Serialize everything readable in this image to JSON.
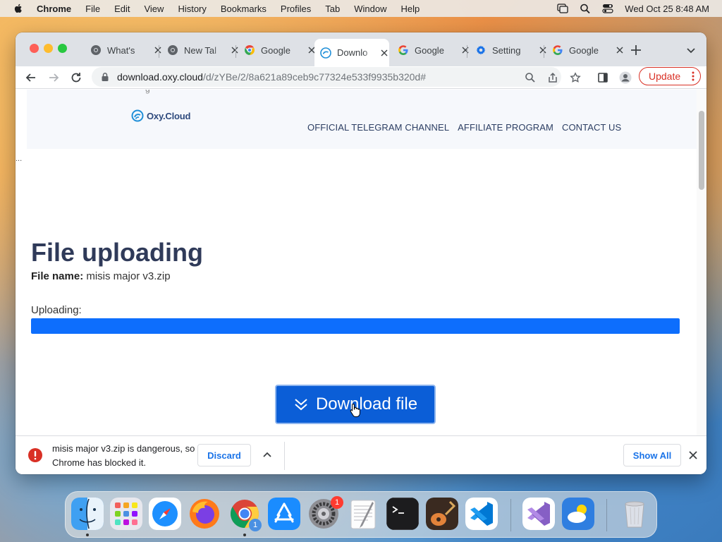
{
  "menubar": {
    "app_name": "Chrome",
    "items": [
      "File",
      "Edit",
      "View",
      "History",
      "Bookmarks",
      "Profiles",
      "Tab",
      "Window",
      "Help"
    ],
    "datetime": "Wed Oct 25  8:48 AM"
  },
  "tabs": [
    {
      "title": "What's",
      "icon": "chrome-logo-icon"
    },
    {
      "title": "New Tal",
      "icon": "chrome-logo-icon"
    },
    {
      "title": "Google",
      "icon": "chrome-color-icon"
    },
    {
      "title": "Downlo",
      "icon": "oxycloud-icon",
      "active": true
    },
    {
      "title": "Google",
      "icon": "google-g-icon"
    },
    {
      "title": "Setting",
      "icon": "gear-icon"
    },
    {
      "title": "Google",
      "icon": "google-g-icon"
    }
  ],
  "toolbar": {
    "url_host": "download.oxy.cloud",
    "url_path": "/d/zYBe/2/8a621a89ceb9c77324e533f9935b320d#",
    "update_label": "Update"
  },
  "site": {
    "logo_text": "Oxy.Cloud",
    "nav": [
      "OFFICIAL TELEGRAM CHANNEL",
      "AFFILIATE PROGRAM",
      "CONTACT US"
    ],
    "ellipsis": "...",
    "crumb": "g"
  },
  "page": {
    "title": "File uploading",
    "file_name_label": "File name:",
    "file_name": "misis major v3.zip",
    "uploading_label": "Uploading:",
    "progress": 1.0,
    "download_label": "Download file"
  },
  "downloadbar": {
    "warning": "misis major v3.zip is dangerous, so Chrome has blocked it.",
    "discard_label": "Discard",
    "show_all_label": "Show All"
  },
  "dock": {
    "badges": {
      "settings": "1",
      "chrome": "1"
    }
  },
  "colors": {
    "accent": "#0b5ed7",
    "progress": "#0d6efd",
    "danger": "#d93025",
    "link": "#1a73e8"
  }
}
